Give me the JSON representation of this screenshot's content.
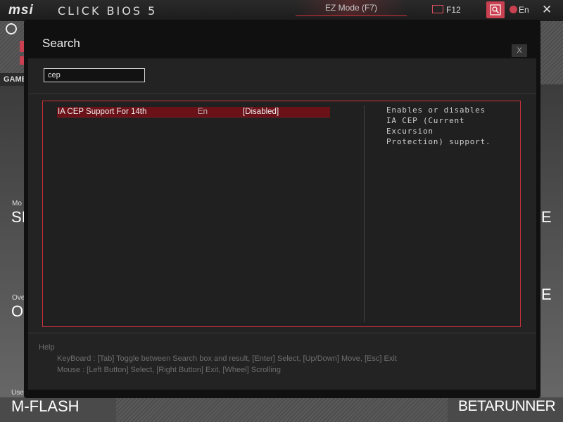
{
  "topbar": {
    "logo": "msi",
    "bios_name": "CLICK BIOS 5",
    "ez_mode": "EZ Mode (F7)",
    "f12": "F12",
    "language": "En",
    "close_glyph": "✕"
  },
  "background": {
    "game_tab": "GAME",
    "labels_small_left": [
      "Mo",
      "Ove"
    ],
    "labels_big_left": [
      "SI",
      "O"
    ],
    "labels_big_right": [
      "E",
      "E"
    ],
    "use_label": "Use",
    "mflash": "M-FLASH",
    "betarunner": "BETARUNNER"
  },
  "dialog": {
    "title": "Search",
    "close_label": "X",
    "search": {
      "value": "cep",
      "placeholder": ""
    },
    "results": [
      {
        "name": "IA CEP Support For 14th",
        "lang": "En",
        "value": "[Disabled]"
      }
    ],
    "description_lines": [
      "Enables or disables",
      "IA CEP (Current",
      "Excursion",
      "Protection) support."
    ],
    "help": {
      "title": "Help",
      "keyboard": "KeyBoard :  [Tab]  Toggle between Search box and result,   [Enter]  Select,   [Up/Down]  Move,   [Esc]  Exit",
      "mouse": "Mouse     :  [Left Button]  Select,   [Right Button]  Exit,   [Wheel]  Scrolling"
    }
  },
  "colors": {
    "accent": "#c8303c",
    "selected_row": "#6b1118",
    "dialog_bg": "#101010",
    "panel_bg": "#232323"
  },
  "icons": [
    "clock-icon",
    "camera-icon",
    "search-icon",
    "globe-icon",
    "close-icon"
  ]
}
